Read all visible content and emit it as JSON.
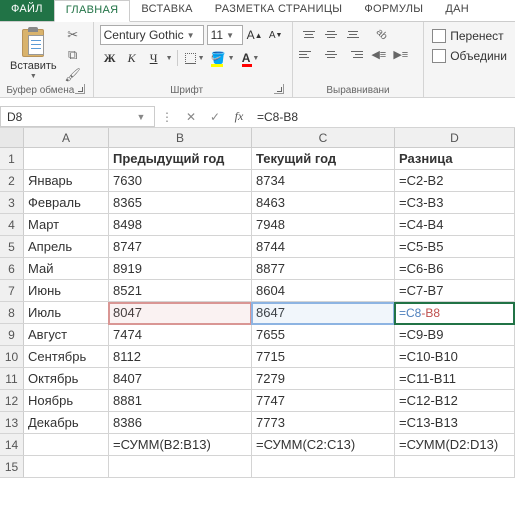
{
  "tabs": {
    "file": "ФАЙЛ",
    "home": "ГЛАВНАЯ",
    "insert": "ВСТАВКА",
    "layout": "РАЗМЕТКА СТРАНИЦЫ",
    "formulas": "ФОРМУЛЫ",
    "data": "ДАН"
  },
  "ribbon": {
    "paste": "Вставить",
    "clipboard_grp": "Буфер обмена",
    "font_name": "Century Gothic",
    "font_size": "11",
    "font_grp": "Шрифт",
    "align_grp": "Выравнивани",
    "wrap": "Перенест",
    "merge": "Объедини"
  },
  "namebox": "D8",
  "formula": "=C8-B8",
  "cols": [
    "A",
    "B",
    "C",
    "D"
  ],
  "rows": [
    {
      "n": "1",
      "A": "",
      "B": "Предыдущий год",
      "C": "Текущий год",
      "D": "Разница",
      "bold": true
    },
    {
      "n": "2",
      "A": "Январь",
      "B": "7630",
      "C": "8734",
      "D": "=C2-B2"
    },
    {
      "n": "3",
      "A": "Февраль",
      "B": "8365",
      "C": "8463",
      "D": "=C3-B3"
    },
    {
      "n": "4",
      "A": "Март",
      "B": "8498",
      "C": "7948",
      "D": "=C4-B4"
    },
    {
      "n": "5",
      "A": "Апрель",
      "B": "8747",
      "C": "8744",
      "D": "=C5-B5"
    },
    {
      "n": "6",
      "A": "Май",
      "B": "8919",
      "C": "8877",
      "D": "=C6-B6"
    },
    {
      "n": "7",
      "A": "Июнь",
      "B": "8521",
      "C": "8604",
      "D": "=C7-B7"
    },
    {
      "n": "8",
      "A": "Июль",
      "B": "8047",
      "C": "8647",
      "D": ""
    },
    {
      "n": "9",
      "A": "Август",
      "B": "7474",
      "C": "7655",
      "D": "=C9-B9"
    },
    {
      "n": "10",
      "A": "Сентябрь",
      "B": "8112",
      "C": "7715",
      "D": "=C10-B10"
    },
    {
      "n": "11",
      "A": "Октябрь",
      "B": "8407",
      "C": "7279",
      "D": "=C11-B11"
    },
    {
      "n": "12",
      "A": "Ноябрь",
      "B": "8881",
      "C": "7747",
      "D": "=C12-B12"
    },
    {
      "n": "13",
      "A": "Декабрь",
      "B": "8386",
      "C": "7773",
      "D": "=C13-B13"
    },
    {
      "n": "14",
      "A": "",
      "B": "=СУММ(B2:B13)",
      "C": "=СУММ(C2:C13)",
      "D": "=СУММ(D2:D13)"
    },
    {
      "n": "15",
      "A": "",
      "B": "",
      "C": "",
      "D": ""
    }
  ],
  "d8": {
    "p1": "=C8",
    "p2": "-B8"
  }
}
